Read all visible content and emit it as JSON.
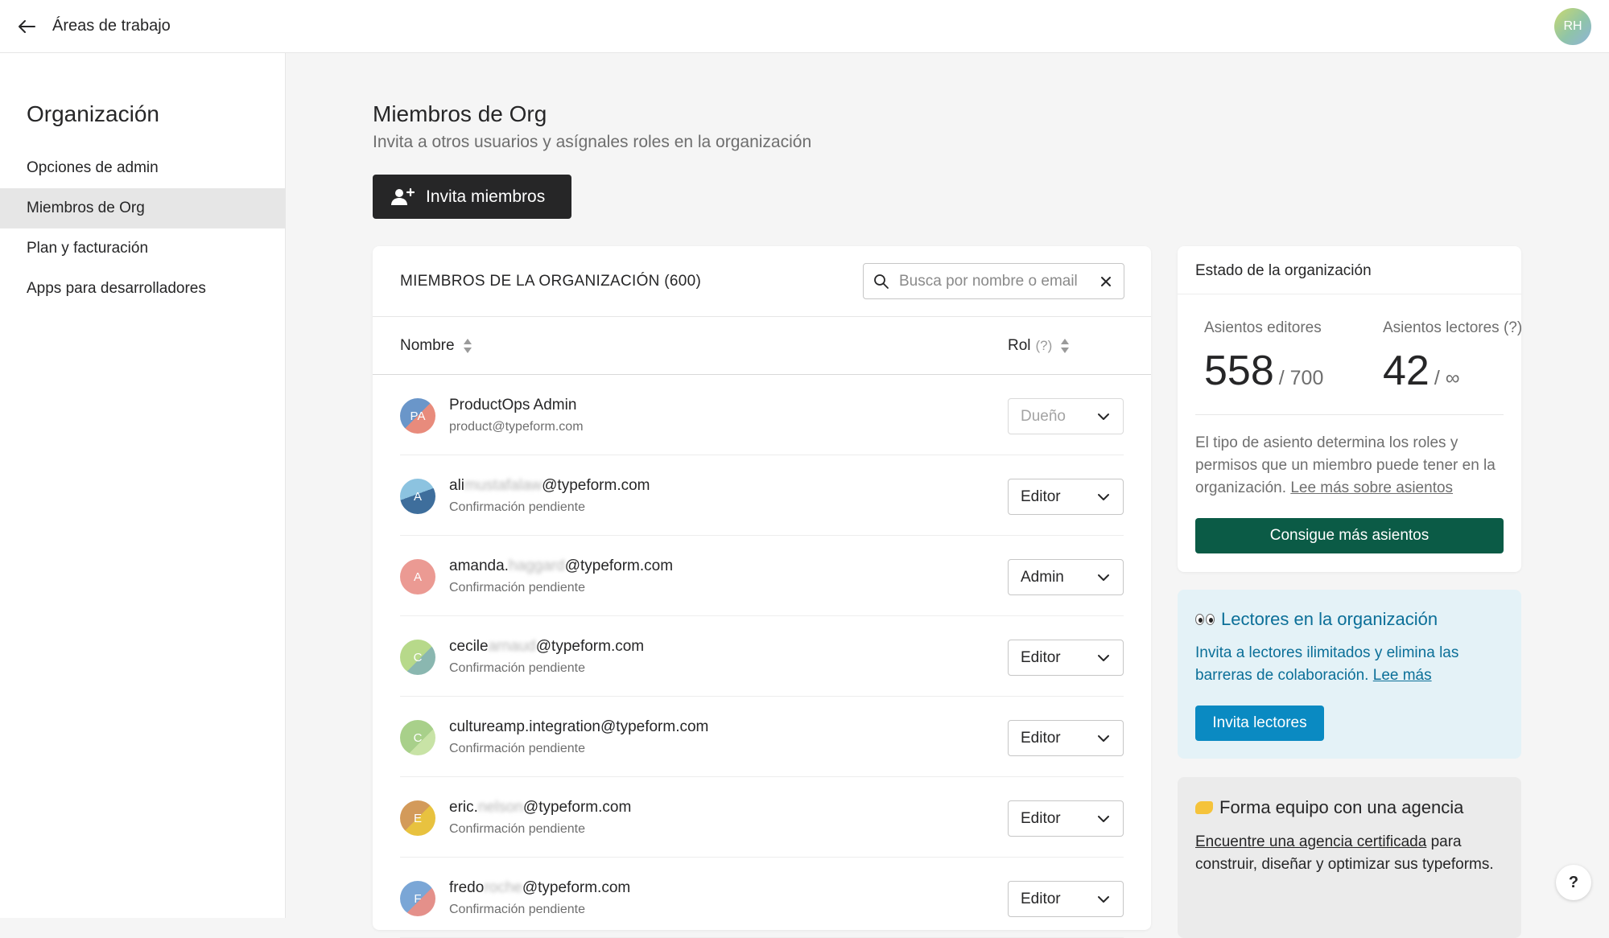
{
  "topbar": {
    "back_title": "Áreas de trabajo",
    "avatar_initials": "RH"
  },
  "sidebar": {
    "heading": "Organización",
    "items": [
      {
        "label": "Opciones de admin"
      },
      {
        "label": "Miembros de Org"
      },
      {
        "label": "Plan y facturación"
      },
      {
        "label": "Apps para desarrolladores"
      }
    ]
  },
  "main": {
    "title": "Miembros de Org",
    "subtitle": "Invita a otros usuarios y asígnales roles en la organización",
    "invite_button": "Invita miembros"
  },
  "members": {
    "title": "MIEMBROS DE LA ORGANIZACIÓN (600)",
    "search_placeholder": "Busca por nombre o email",
    "col_name": "Nombre",
    "col_role": "Rol",
    "col_role_help": "(?)",
    "rows": [
      {
        "initials": "PA",
        "name": "ProductOps Admin",
        "blur": "",
        "domain": "",
        "sub": "product@typeform.com",
        "role": "Dueño"
      },
      {
        "initials": "A",
        "name": "ali",
        "blur": "mustafalaw",
        "domain": "@typeform.com",
        "sub": "Confirmación pendiente",
        "role": "Editor"
      },
      {
        "initials": "A",
        "name": "amanda.",
        "blur": "haggard",
        "domain": "@typeform.com",
        "sub": "Confirmación pendiente",
        "role": "Admin"
      },
      {
        "initials": "C",
        "name": "cecile",
        "blur": "arnaud",
        "domain": "@typeform.com",
        "sub": "Confirmación pendiente",
        "role": "Editor"
      },
      {
        "initials": "C",
        "name": "cultureamp.integration@typeform.com",
        "blur": "",
        "domain": "",
        "sub": "Confirmación pendiente",
        "role": "Editor"
      },
      {
        "initials": "E",
        "name": "eric.",
        "blur": "nelson",
        "domain": "@typeform.com",
        "sub": "Confirmación pendiente",
        "role": "Editor"
      },
      {
        "initials": "F",
        "name": "fredo",
        "blur": "roche",
        "domain": "@typeform.com",
        "sub": "Confirmación pendiente",
        "role": "Editor"
      }
    ]
  },
  "status": {
    "title": "Estado de la organización",
    "editor_label": "Asientos editores",
    "editor_used": "558",
    "editor_total": "/ 700",
    "reader_label": "Asientos lectores (?)",
    "reader_used": "42",
    "reader_total": "/ ∞",
    "desc": "El tipo de asiento determina los roles y permisos que un miembro puede tener en la organización.",
    "desc_link": "Lee más sobre asientos",
    "button": "Consigue más asientos"
  },
  "readers": {
    "title": "Lectores en la organización",
    "desc": "Invita a lectores ilimitados y elimina las barreras de colaboración.",
    "desc_link": "Lee más",
    "button": "Invita lectores"
  },
  "agency": {
    "title": "Forma equipo con una agencia",
    "link": "Encuentre una agencia certificada",
    "desc": "para construir, diseñar y optimizar sus typeforms."
  },
  "help": {
    "label": "?"
  },
  "colors": {
    "primary_dark": "#262627",
    "seats_button": "#0b5b46",
    "readers_accent": "#0b6f98",
    "readers_button": "#0a8ac2",
    "readers_bg": "#e4f2f7"
  }
}
